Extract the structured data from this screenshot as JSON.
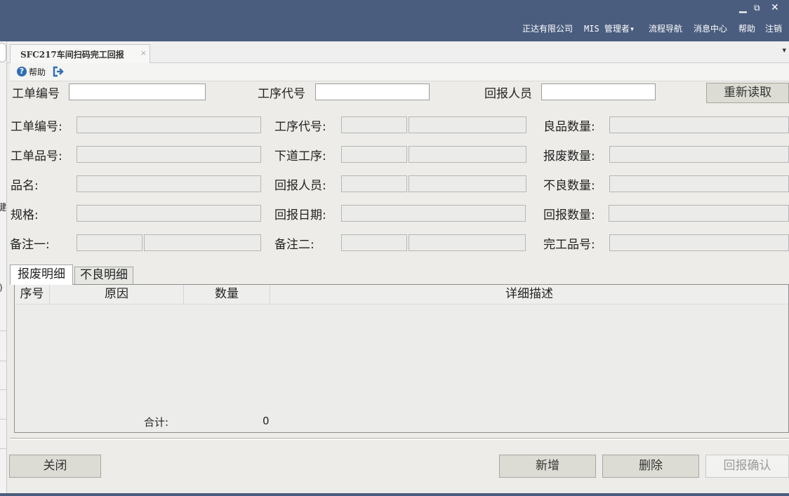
{
  "window": {
    "minimize": "▁",
    "restore": "⧉",
    "close": "✕"
  },
  "topnav": {
    "company": "正达有限公司",
    "user": "MIS 管理者",
    "user_caret": "▾",
    "flow": "流程导航",
    "messages": "消息中心",
    "help": "帮助",
    "logout": "注销"
  },
  "tabs": [
    {
      "label": "SFC217车间扫码完工回报",
      "close": "×"
    }
  ],
  "tab_overflow": "▾",
  "toolbar": {
    "help_icon": "?",
    "help_label": "帮助",
    "exit_icon": "exit-icon"
  },
  "search": {
    "work_order_label": "工单编号",
    "work_order_value": "",
    "process_label": "工序代号",
    "process_value": "",
    "reporter_label": "回报人员",
    "reporter_value": "",
    "reload_label": "重新读取"
  },
  "form": {
    "work_order": "工单编号:",
    "process_code": "工序代号:",
    "good_qty": "良品数量:",
    "product_no": "工单品号:",
    "next_process": "下道工序:",
    "scrap_qty": "报废数量:",
    "product_name": "品名:",
    "reporter": "回报人员:",
    "defect_qty": "不良数量:",
    "spec": "规格:",
    "report_date": "回报日期:",
    "report_qty": "回报数量:",
    "remark1": "备注一:",
    "remark2": "备注二:",
    "finished_no": "完工品号:"
  },
  "detail_tabs": {
    "scrap": "报废明细",
    "defect": "不良明细"
  },
  "grid": {
    "columns": [
      "序号",
      "原因",
      "数量",
      "详细描述"
    ],
    "total_label": "合计:",
    "total_value": "0"
  },
  "buttons": {
    "close": "关闭",
    "add": "新增",
    "delete": "删除",
    "confirm": "回报确认"
  },
  "left_fragments": {
    "a": "键",
    "b": ":)"
  },
  "colors": {
    "topbar": "#4a5d7e",
    "background": "#edece8",
    "button": "#dcdcd4",
    "help_icon": "#2f6db5"
  }
}
